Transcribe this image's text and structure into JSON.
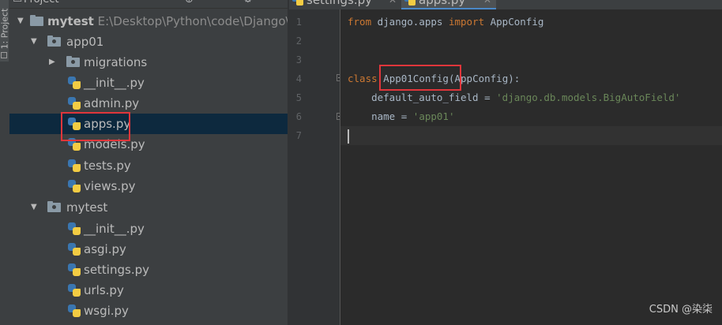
{
  "tool_strip": {
    "label": "1: Project"
  },
  "panel_header": {
    "title": "Project",
    "gear_icon": "gear-icon",
    "target_icon": "target-icon"
  },
  "tree": {
    "root": {
      "name": "mytest",
      "path": "E:\\Desktop\\Python\\code\\Django\\r"
    },
    "app01": {
      "name": "app01"
    },
    "migrations": {
      "name": "migrations"
    },
    "app01_files": [
      "__init__.py",
      "admin.py",
      "apps.py",
      "models.py",
      "tests.py",
      "views.py"
    ],
    "mytest_pkg": {
      "name": "mytest"
    },
    "mytest_files": [
      "__init__.py",
      "asgi.py",
      "settings.py",
      "urls.py",
      "wsgi.py"
    ],
    "selected": "apps.py"
  },
  "tabs": [
    {
      "label": "settings.py",
      "active": false
    },
    {
      "label": "apps.py",
      "active": true
    }
  ],
  "editor": {
    "line_numbers": [
      "1",
      "2",
      "3",
      "4",
      "5",
      "6",
      "7"
    ],
    "line1": {
      "kw1": "from",
      "mod": " django.apps ",
      "kw2": "import",
      "name": " AppConfig"
    },
    "line4": {
      "kw": "class",
      "cls": "App01Config",
      "rest": "(AppConfig):"
    },
    "line5": {
      "attr": "    default_auto_field = ",
      "str": "'django.db.models.BigAutoField'"
    },
    "line6": {
      "attr": "    name = ",
      "str": "'app01'"
    }
  },
  "colors": {
    "highlight": "#e0363b",
    "selection": "#0d293e",
    "keyword": "#cc7832",
    "string": "#6a8759"
  },
  "watermark": "CSDN @染柒"
}
